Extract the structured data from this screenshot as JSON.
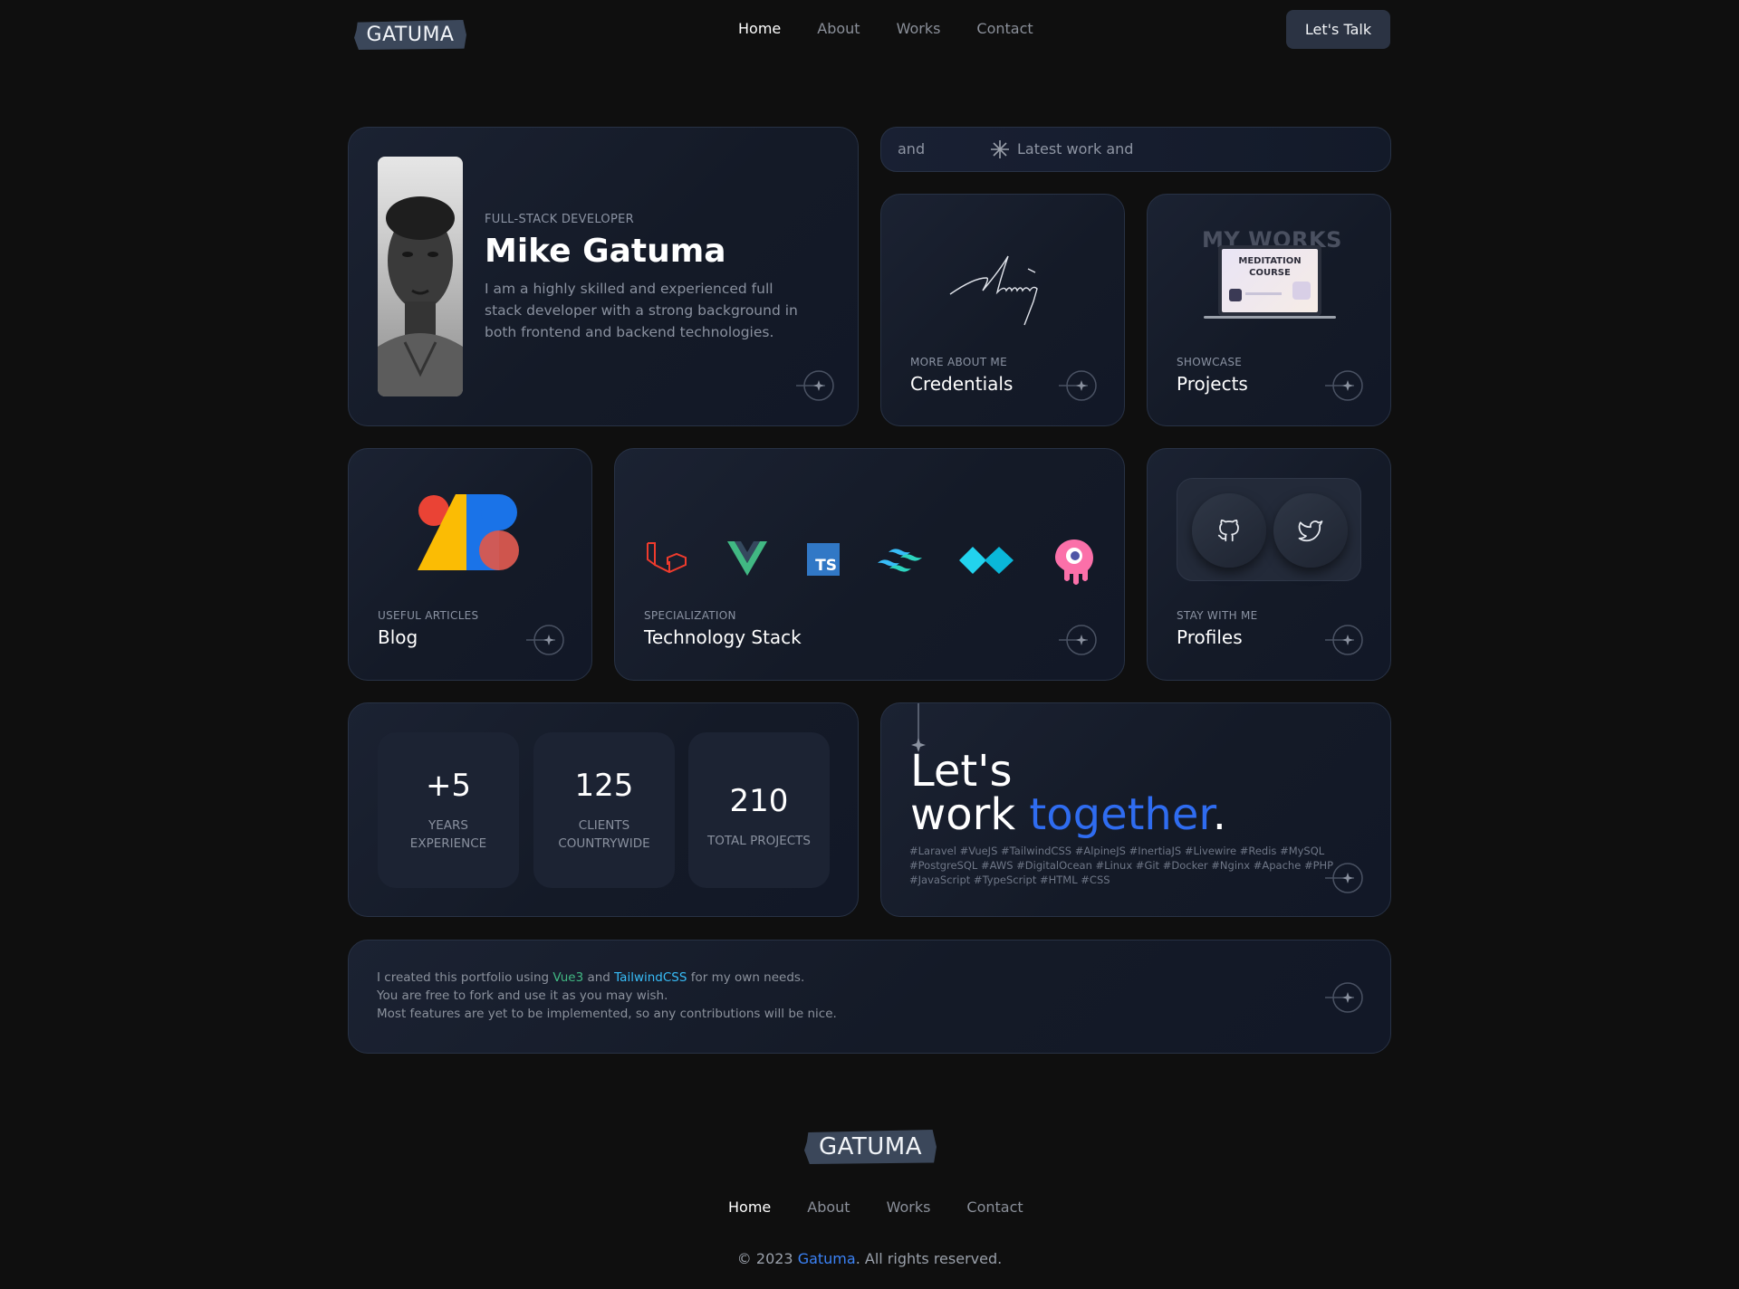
{
  "header": {
    "logo": "GATUMA",
    "nav": [
      "Home",
      "About",
      "Works",
      "Contact"
    ],
    "cta": "Let's Talk"
  },
  "profile": {
    "role": "FULL-STACK DEVELOPER",
    "name": "Mike Gatuma",
    "bio": "I am a highly skilled and experienced full stack developer with a strong background in both frontend and backend technologies."
  },
  "marquee": {
    "left_text": "and",
    "text": "Latest work and"
  },
  "credentials": {
    "eyebrow": "MORE ABOUT ME",
    "title": "Credentials"
  },
  "projects": {
    "eyebrow": "SHOWCASE",
    "title": "Projects",
    "thumb_heading": "MY WORKS",
    "thumb_line1": "MEDITATION",
    "thumb_line2": "COURSE"
  },
  "blog": {
    "eyebrow": "USEFUL ARTICLES",
    "title": "Blog"
  },
  "tech": {
    "eyebrow": "SPECIALIZATION",
    "title": "Technology Stack",
    "icons": [
      "laravel-icon",
      "vue-icon",
      "typescript-icon",
      "tailwind-icon",
      "alpine-icon",
      "livewire-icon"
    ],
    "ts_label": "TS"
  },
  "profiles": {
    "eyebrow": "STAY WITH ME",
    "title": "Profiles",
    "icons": [
      "github-icon",
      "twitter-icon"
    ]
  },
  "stats": [
    {
      "value": "+5",
      "label1": "YEARS",
      "label2": "EXPERIENCE"
    },
    {
      "value": "125",
      "label1": "CLIENTS",
      "label2": "COUNTRYWIDE"
    },
    {
      "value": "210",
      "label1": "TOTAL PROJECTS",
      "label2": ""
    }
  ],
  "cta": {
    "line1": "Let's",
    "line2_a": "work ",
    "line2_b": "together",
    "line2_c": ".",
    "hashtags": "#Laravel #VueJS #TailwindCSS #AlpineJS #InertiaJS #Livewire #Redis #MySQL #PostgreSQL #AWS #DigitalOcean #Linux #Git #Docker #Nginx #Apache #PHP #JavaScript #TypeScript #HTML #CSS"
  },
  "note": {
    "l1_a": "I created this portfolio using ",
    "l1_vue": "Vue3",
    "l1_and": " and ",
    "l1_tw": "TailwindCSS",
    "l1_b": " for my own needs.",
    "l2": "You are free to fork and use it as you may wish.",
    "l3": "Most features are yet to be implemented, so any contributions will be nice."
  },
  "footer": {
    "logo": "GATUMA",
    "nav": [
      "Home",
      "About",
      "Works",
      "Contact"
    ],
    "copyright_a": "© 2023 ",
    "copyright_link": "Gatuma",
    "copyright_b": ". All rights reserved."
  },
  "colors": {
    "background": "#0f0f0f",
    "card": "#171d2b",
    "accent_blue": "#2f6cf0",
    "vue_green": "#41b883",
    "tailwind_cyan": "#38bdf8"
  }
}
